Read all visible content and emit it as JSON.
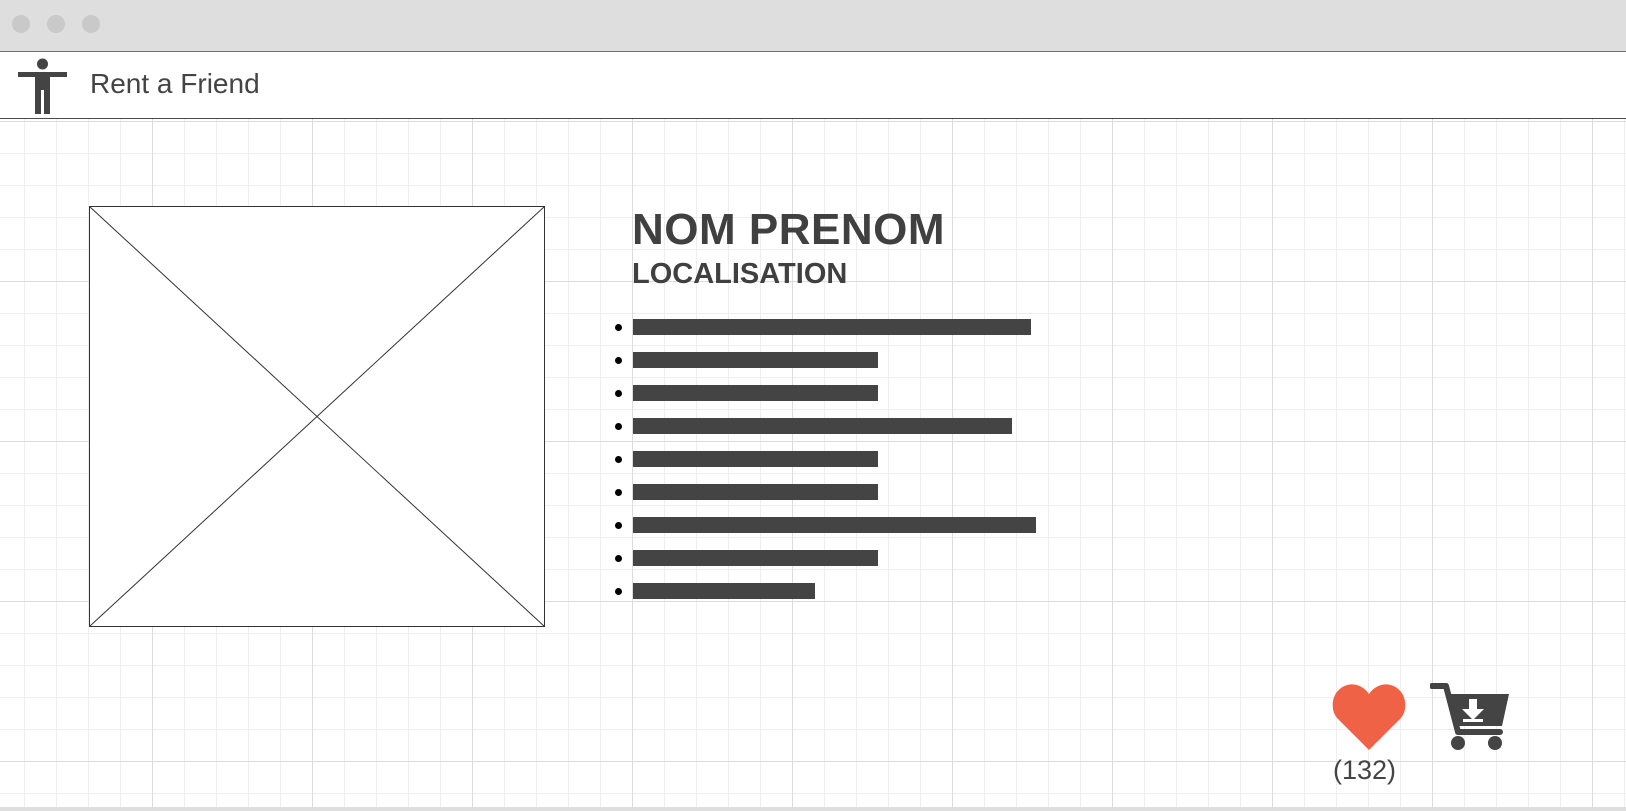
{
  "app": {
    "title": "Rent a Friend",
    "logo_icon": "accessibility-person-icon"
  },
  "profile": {
    "name": "NOM PRENOM",
    "location": "LOCALISATION",
    "photo": "image-placeholder",
    "features": [
      {
        "fill": 0.83
      },
      {
        "fill": 0.51
      },
      {
        "fill": 0.51
      },
      {
        "fill": 0.79
      },
      {
        "fill": 0.51
      },
      {
        "fill": 0.51
      },
      {
        "fill": 0.84
      },
      {
        "fill": 0.51
      },
      {
        "fill": 0.38
      }
    ]
  },
  "actions": {
    "like_icon": "heart-icon",
    "like_count": "(132)",
    "cart_icon": "cart-download-icon"
  },
  "colors": {
    "heart": "#f06245",
    "ink": "#444444",
    "grid": "#dcdcdc"
  }
}
